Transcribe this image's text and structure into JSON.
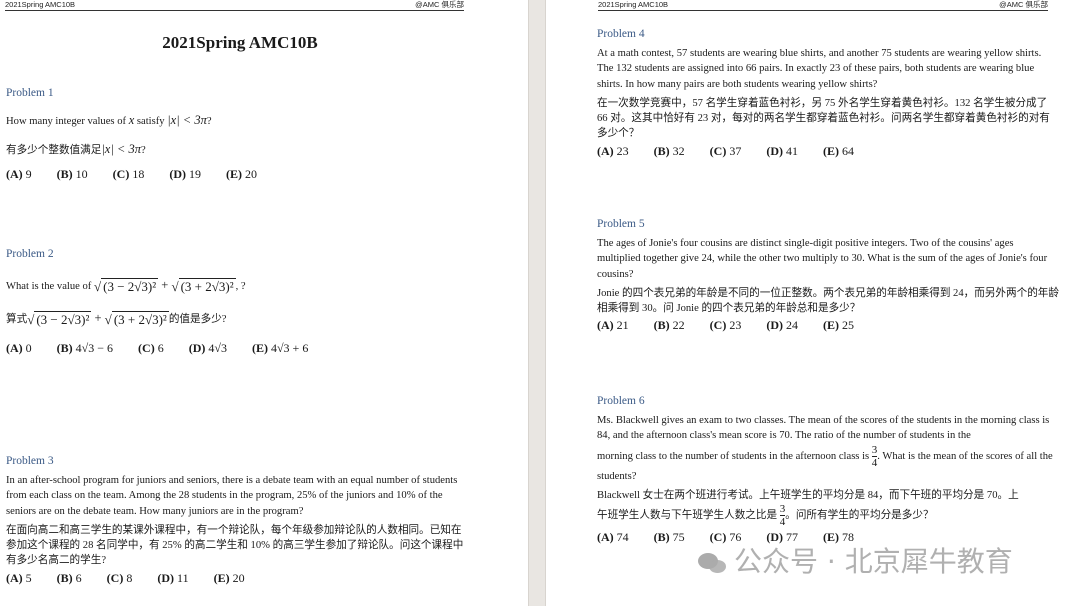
{
  "header": {
    "left": "2021Spring AMC10B",
    "right": "@AMC 俱乐部"
  },
  "document_title": "2021Spring AMC10B",
  "problems": [
    {
      "title": "Problem 1",
      "en_prefix": "How many integer values of ",
      "en_var": "x",
      "en_mid": " satisfy ",
      "en_math": "|x| < 3π",
      "en_suffix": "?",
      "zh_prefix": "有多少个整数值满足",
      "zh_math": "|x| < 3π",
      "zh_suffix": "?",
      "choices": [
        {
          "label": "(A)",
          "value": "9"
        },
        {
          "label": "(B)",
          "value": "10"
        },
        {
          "label": "(C)",
          "value": "18"
        },
        {
          "label": "(D)",
          "value": "19"
        },
        {
          "label": "(E)",
          "value": "20"
        }
      ]
    },
    {
      "title": "Problem 2",
      "en_prefix": "What is the value of ",
      "expr_a": "(3 − 2√3)²",
      "expr_plus": " + ",
      "expr_b": "(3 + 2√3)²",
      "en_suffix": ", ?",
      "zh_prefix": "算式",
      "zh_suffix": "的值是多少?",
      "choices": [
        {
          "label": "(A)",
          "value": "0"
        },
        {
          "label": "(B)",
          "value": "4√3 − 6"
        },
        {
          "label": "(C)",
          "value": "6"
        },
        {
          "label": "(D)",
          "value": "4√3"
        },
        {
          "label": "(E)",
          "value": "4√3 + 6"
        }
      ]
    },
    {
      "title": "Problem 3",
      "en": "In an after-school program for juniors and seniors, there is a debate team with an equal number of students from each class on the team. Among the 28 students in the program, 25% of the juniors and 10% of the seniors are on the debate team. How many juniors are in the program?",
      "zh": "在面向高二和高三学生的某课外课程中，有一个辩论队，每个年级参加辩论队的人数相同。已知在参加这个课程的 28 名同学中，有 25% 的高二学生和 10% 的高三学生参加了辩论队。问这个课程中有多少名高二的学生?",
      "choices": [
        {
          "label": "(A)",
          "value": "5"
        },
        {
          "label": "(B)",
          "value": "6"
        },
        {
          "label": "(C)",
          "value": "8"
        },
        {
          "label": "(D)",
          "value": "11"
        },
        {
          "label": "(E)",
          "value": "20"
        }
      ]
    },
    {
      "title": "Problem 4",
      "en": "At a math contest, 57 students are wearing blue shirts, and another 75 students are wearing yellow shirts. The 132 students are assigned into 66 pairs. In exactly 23 of these pairs, both students are wearing blue shirts. In how many pairs are both students wearing yellow shirts?",
      "zh": "在一次数学竞赛中，57 名学生穿着蓝色衬衫，另 75 外名学生穿着黄色衬衫。132 名学生被分成了 66 对。这其中恰好有 23 对，每对的两名学生都穿着蓝色衬衫。问两名学生都穿着黄色衬衫的对有多少个？",
      "choices": [
        {
          "label": "(A)",
          "value": "23"
        },
        {
          "label": "(B)",
          "value": "32"
        },
        {
          "label": "(C)",
          "value": "37"
        },
        {
          "label": "(D)",
          "value": "41"
        },
        {
          "label": "(E)",
          "value": "64"
        }
      ]
    },
    {
      "title": "Problem 5",
      "en": "The ages of Jonie's four cousins are distinct single-digit positive integers. Two of the cousins' ages multiplied together give 24, while the other two multiply to 30. What is the sum of the ages of Jonie's four cousins?",
      "zh": "Jonie 的四个表兄弟的年龄是不同的一位正整数。两个表兄弟的年龄相乘得到 24，而另外两个的年龄相乘得到 30。问 Jonie 的四个表兄弟的年龄总和是多少？",
      "choices": [
        {
          "label": "(A)",
          "value": "21"
        },
        {
          "label": "(B)",
          "value": "22"
        },
        {
          "label": "(C)",
          "value": "23"
        },
        {
          "label": "(D)",
          "value": "24"
        },
        {
          "label": "(E)",
          "value": "25"
        }
      ]
    },
    {
      "title": "Problem 6",
      "en_line1": "Ms. Blackwell gives an exam to two classes. The mean of the scores of the students in the morning class is 84, and the afternoon class's mean score is 70. The ratio of the number of students in the",
      "en_line2_prefix": "morning class to the number of students in the afternoon class is ",
      "frac_num": "3",
      "frac_den": "4",
      "en_line2_suffix": ". What is the mean of the scores of all the students?",
      "zh_line1": "Blackwell 女士在两个班进行考试。上午班学生的平均分是 84，而下午班的平均分是 70。上",
      "zh_line2_prefix": "午班学生人数与下午班学生人数之比是 ",
      "zh_line2_suffix": "。问所有学生的平均分是多少？",
      "choices": [
        {
          "label": "(A)",
          "value": "74"
        },
        {
          "label": "(B)",
          "value": "75"
        },
        {
          "label": "(C)",
          "value": "76"
        },
        {
          "label": "(D)",
          "value": "77"
        },
        {
          "label": "(E)",
          "value": "78"
        }
      ]
    }
  ],
  "watermark": {
    "icon": "wechat-icon",
    "text": "公众号 · 北京犀牛教育"
  }
}
